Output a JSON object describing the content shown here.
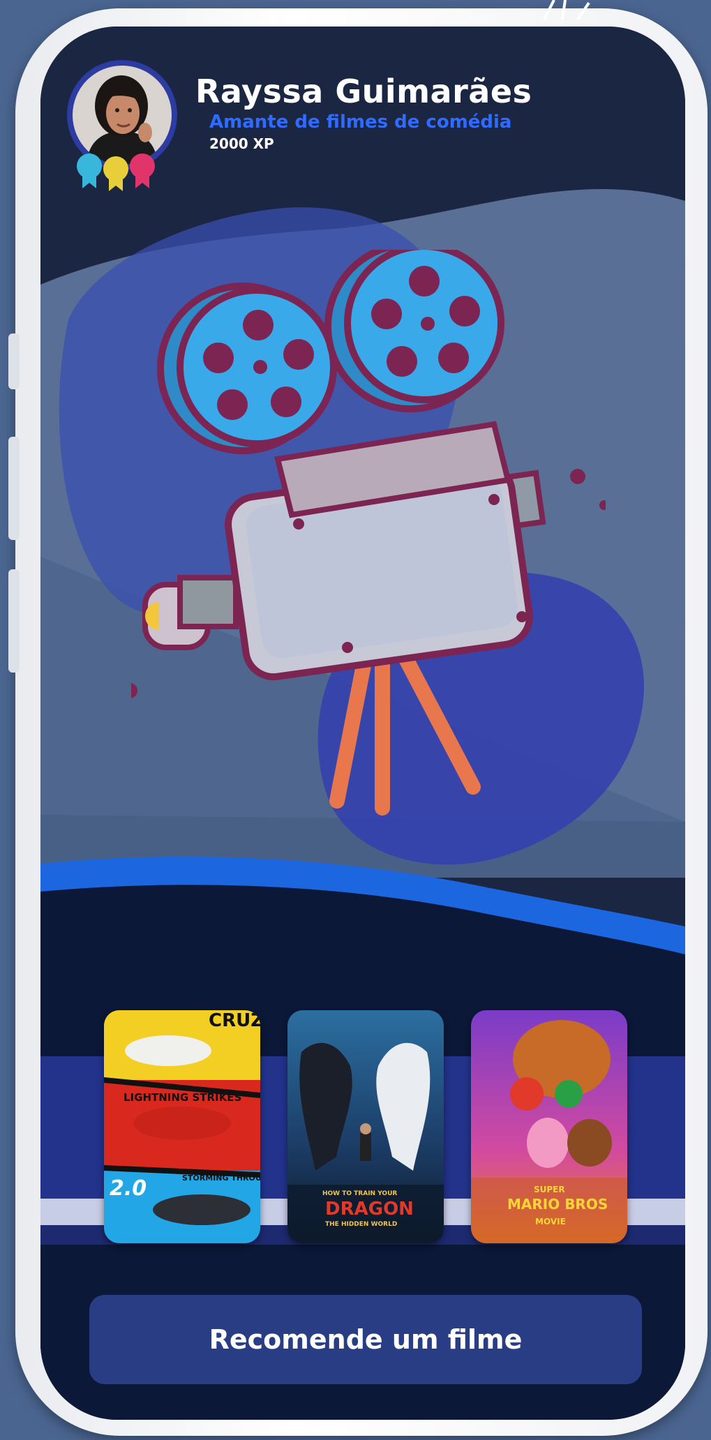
{
  "profile": {
    "name": "Rayssa Guimarães",
    "subtitle": "Amante de filmes de comédia",
    "xp": "2000 XP",
    "badge_colors": [
      "#39b6dc",
      "#e8cf3a",
      "#e0346a"
    ]
  },
  "illustration": {
    "icon": "film-projector-icon"
  },
  "movies": [
    {
      "title_text": "CRUZ",
      "tagline": "LIGHTNING STRIKES",
      "number": "2.0",
      "subtitle": "STORMING THROUGH"
    },
    {
      "title_text": "DRAGON",
      "tagline": "HOW TO TRAIN YOUR",
      "subtitle": "THE HIDDEN WORLD"
    },
    {
      "title_text": "MARIO BROS",
      "tagline": "SUPER",
      "subtitle": "MOVIE"
    }
  ],
  "actions": {
    "recommend_label": "Recomende um filme"
  },
  "colors": {
    "background": "#4a6590",
    "screen": "#1b2642",
    "accent_blue": "#2f6bff",
    "button": "#283d84",
    "reel_blue": "#39a9ea",
    "reel_maroon": "#7c2452"
  }
}
